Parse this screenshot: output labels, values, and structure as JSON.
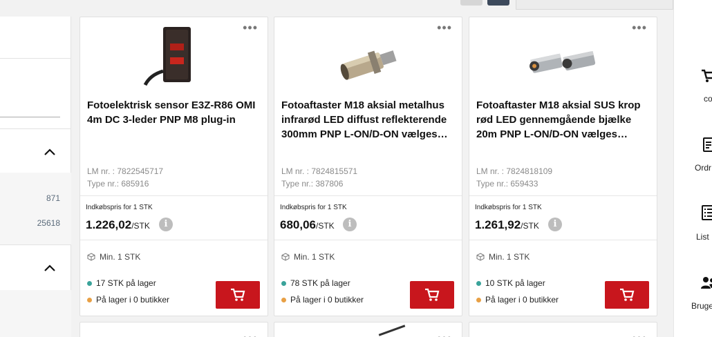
{
  "filter_panel": {
    "counts": [
      "871",
      "25618"
    ]
  },
  "products": [
    {
      "title": "Fotoelektrisk sensor E3Z-R86 OMI 4m DC 3-leder PNP M8 plug-in",
      "lm_label": "LM nr. : 7822545717",
      "type_label": "Type nr.: 685916",
      "price_label": "Indkøbspris for 1 STK",
      "price": "1.226,02",
      "unit": "/STK",
      "min_order": "Min. 1 STK",
      "stock": "17 STK på lager",
      "store_stock": "På lager i 0 butikker",
      "image_icon": "photoelectric-sensor-image"
    },
    {
      "title": "Fotoaftaster M18 aksial metalhus infrarød LED diffust reflekterende 300mm PNP L-ON/D-ON vælges…",
      "lm_label": "LM nr. : 7824815571",
      "type_label": "Type nr.: 387806",
      "price_label": "Indkøbspris for 1 STK",
      "price": "680,06",
      "unit": "/STK",
      "min_order": "Min. 1 STK",
      "stock": "78 STK på lager",
      "store_stock": "På lager i 0 butikker",
      "image_icon": "cylindrical-sensor-image"
    },
    {
      "title": "Fotoaftaster M18 aksial SUS krop rød LED gennemgående bjælke 20m PNP L-ON/D-ON vælges…",
      "lm_label": "LM nr. : 7824818109",
      "type_label": "Type nr.: 659433",
      "price_label": "Indkøbspris for 1 STK",
      "price": "1.261,92",
      "unit": "/STK",
      "min_order": "Min. 1 STK",
      "stock": "10 STK på lager",
      "store_stock": "På lager i 0 butikker",
      "image_icon": "sensor-pair-image"
    }
  ],
  "right_sidebar": [
    {
      "label": "co",
      "icon": "cart-icon"
    },
    {
      "label": "Ordr",
      "icon": "orders-icon"
    },
    {
      "label": "List",
      "icon": "list-icon"
    },
    {
      "label": "Bruge",
      "icon": "users-icon"
    }
  ],
  "colors": {
    "cart_button": "#c8161d",
    "stock_dot": "#3aa39a",
    "store_dot": "#e8a045",
    "view_toggle_active": "#3d4a5c"
  }
}
